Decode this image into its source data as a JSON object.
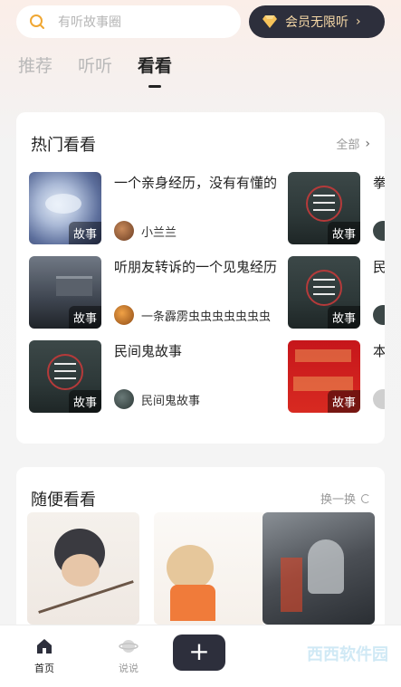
{
  "search": {
    "placeholder": "有听故事圈",
    "icon": "search-icon"
  },
  "vip_button": {
    "label": "会员无限听",
    "icon": "gem-icon",
    "color": "#2d2f3c",
    "text_color": "#f6d8a6"
  },
  "tabs": [
    {
      "label": "推荐",
      "active": false
    },
    {
      "label": "听听",
      "active": false
    },
    {
      "label": "看看",
      "active": true
    }
  ],
  "hot": {
    "title": "热门看看",
    "more_label": "全部",
    "items": [
      {
        "title": "一个亲身经历，没有有懂的",
        "tag": "故事",
        "author": "小兰兰"
      },
      {
        "title": "听朋友转诉的一个见鬼经历",
        "tag": "故事",
        "author": "一条霹雳虫虫虫虫虫虫虫"
      },
      {
        "title": "民间鬼故事",
        "tag": "故事",
        "author": "民间鬼故事"
      }
    ],
    "side_items": [
      {
        "tag": "故事",
        "title_peek": "拳"
      },
      {
        "tag": "故事",
        "title_peek": "民"
      },
      {
        "tag": "故事",
        "title_peek": "本"
      }
    ]
  },
  "random": {
    "title": "随便看看",
    "refresh_label": "换一换"
  },
  "bottom_nav": {
    "home_label": "首页",
    "talk_label": "说说",
    "plus_label": "+",
    "watermark": "西西软件园"
  }
}
